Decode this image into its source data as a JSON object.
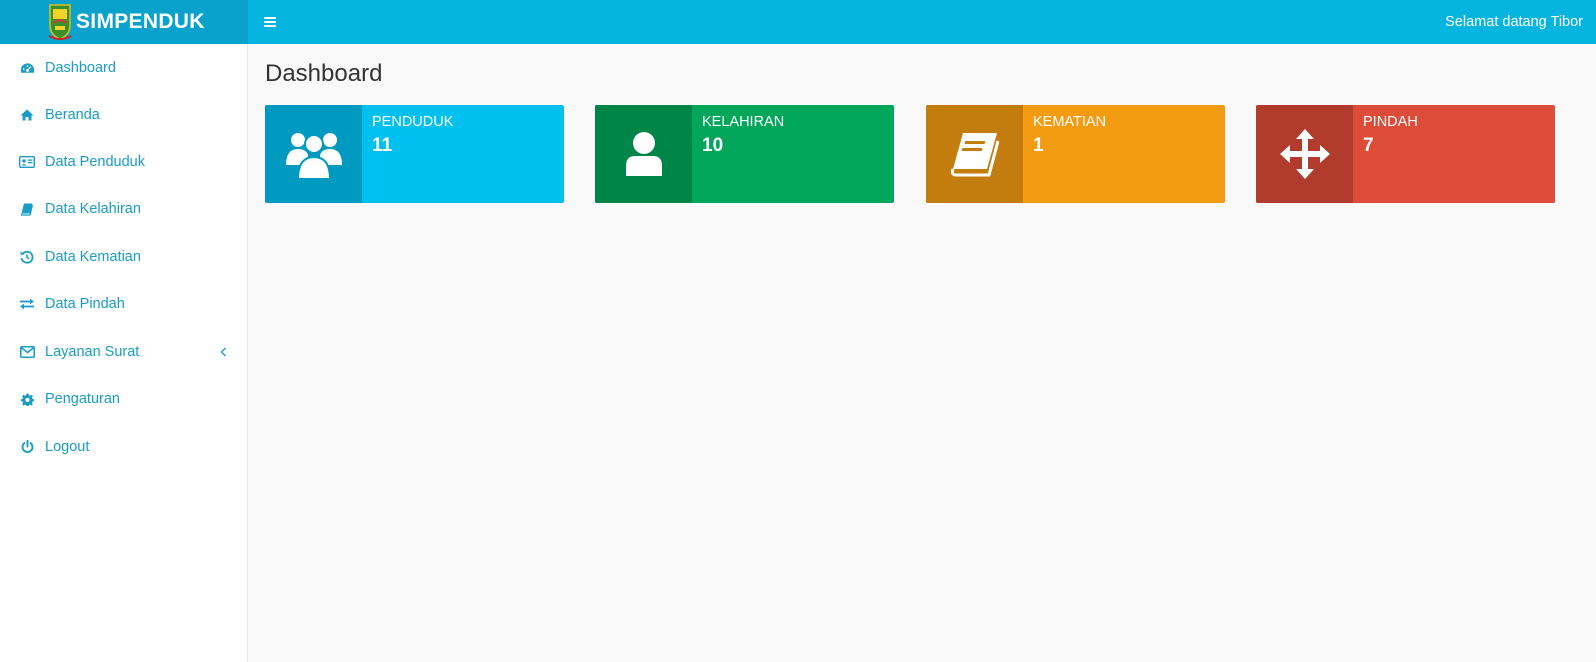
{
  "app": {
    "brand": "SIMPENDUK",
    "welcome": "Selamat datang Tibor"
  },
  "sidebar": {
    "items": [
      {
        "label": "Dashboard",
        "icon": "dashboard-icon"
      },
      {
        "label": "Beranda",
        "icon": "home-icon"
      },
      {
        "label": "Data Penduduk",
        "icon": "id-card-icon"
      },
      {
        "label": "Data Kelahiran",
        "icon": "book-icon"
      },
      {
        "label": "Data Kematian",
        "icon": "history-icon"
      },
      {
        "label": "Data Pindah",
        "icon": "exchange-icon"
      },
      {
        "label": "Layanan Surat",
        "icon": "envelope-icon"
      },
      {
        "label": "Pengaturan",
        "icon": "gear-icon"
      },
      {
        "label": "Logout",
        "icon": "power-icon"
      }
    ]
  },
  "main": {
    "title": "Dashboard",
    "cards": [
      {
        "title": "PENDUDUK",
        "value": "11",
        "icon": "users-icon",
        "color": "#00c0ef",
        "icon_bg": "#009ac1"
      },
      {
        "title": "KELAHIRAN",
        "value": "10",
        "icon": "user-icon",
        "color": "#00a65a",
        "icon_bg": "#008548"
      },
      {
        "title": "KEMATIAN",
        "value": "1",
        "icon": "book-icon",
        "color": "#f39c12",
        "icon_bg": "#c27d0e"
      },
      {
        "title": "PINDAH",
        "value": "7",
        "icon": "move-arrows-icon",
        "color": "#dd4b39",
        "icon_bg": "#b13c2e"
      }
    ]
  },
  "colors": {
    "header": "#05b4df",
    "brand_bg": "#0aa2cc",
    "nav_text": "#1a9cc6"
  }
}
